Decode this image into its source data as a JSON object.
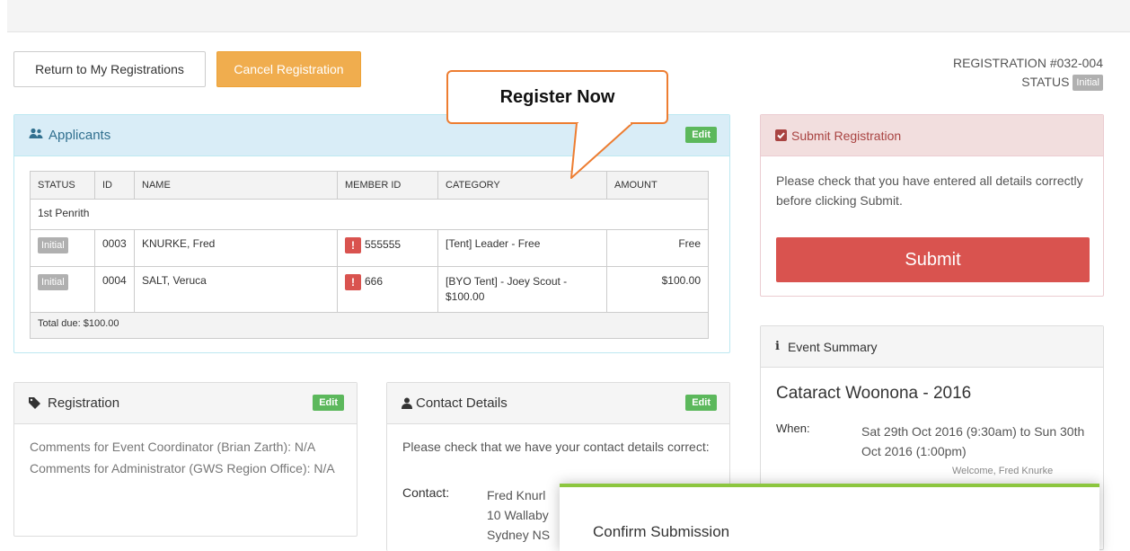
{
  "toolbar": {
    "return_label": "Return to My Registrations",
    "cancel_label": "Cancel Registration"
  },
  "registration_info": {
    "number_label": "REGISTRATION #032-004",
    "status_label": "STATUS",
    "status_value": "Initial"
  },
  "callout": {
    "text": "Register Now"
  },
  "applicants": {
    "title": "Applicants",
    "edit_label": "Edit",
    "columns": [
      "STATUS",
      "ID",
      "NAME",
      "MEMBER ID",
      "CATEGORY",
      "AMOUNT"
    ],
    "group": "1st Penrith",
    "rows": [
      {
        "status": "Initial",
        "id": "0003",
        "name": "KNURKE, Fred",
        "member_id": "555555",
        "category": "[Tent] Leader - Free",
        "amount": "Free"
      },
      {
        "status": "Initial",
        "id": "0004",
        "name": "SALT, Veruca",
        "member_id": "666",
        "category": "[BYO Tent] - Joey Scout - $100.00",
        "amount": "$100.00"
      }
    ],
    "total": "Total due: $100.00"
  },
  "submit_registration": {
    "title": "Submit Registration",
    "text": "Please check that you have entered all details correctly before clicking Submit.",
    "button_label": "Submit"
  },
  "event_summary": {
    "title": "Event Summary",
    "event_name": "Cataract Woonona - 2016",
    "when_label": "When:",
    "when_value": "Sat 29th Oct 2016 (9:30am) to Sun 30th Oct 2016 (1:00pm)"
  },
  "registration_panel": {
    "title": "Registration",
    "edit_label": "Edit",
    "coordinator_comments": "Comments for Event Coordinator (Brian Zarth): N/A",
    "admin_comments": "Comments for Administrator (GWS Region Office): N/A"
  },
  "contact_details": {
    "title": "Contact Details",
    "edit_label": "Edit",
    "intro": "Please check that we have your contact details correct:",
    "contact_label": "Contact:",
    "lines": [
      "Fred Knurl",
      "10 Wallaby",
      "Sydney NS"
    ]
  },
  "welcome": "Welcome, Fred Knurke",
  "modal": {
    "title": "Confirm Submission"
  },
  "colors": {
    "warning": "#f0ad4e",
    "danger": "#d9534f",
    "success": "#5cb85c",
    "info_bg": "#d9edf7",
    "callout_border": "#ed7d31"
  }
}
